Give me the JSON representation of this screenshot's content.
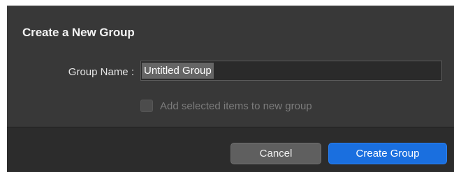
{
  "dialog": {
    "title": "Create a New Group",
    "group_name_label": "Group Name :",
    "group_name_value": "Untitled Group",
    "checkbox_label": "Add selected items to new group",
    "checkbox_checked": false,
    "checkbox_enabled": false
  },
  "buttons": {
    "cancel_label": "Cancel",
    "create_label": "Create Group"
  },
  "colors": {
    "dialog_bg": "#383838",
    "footer_bg": "#2c2c2c",
    "primary_button": "#1a6fdf",
    "secondary_button": "#5f5f5f"
  }
}
